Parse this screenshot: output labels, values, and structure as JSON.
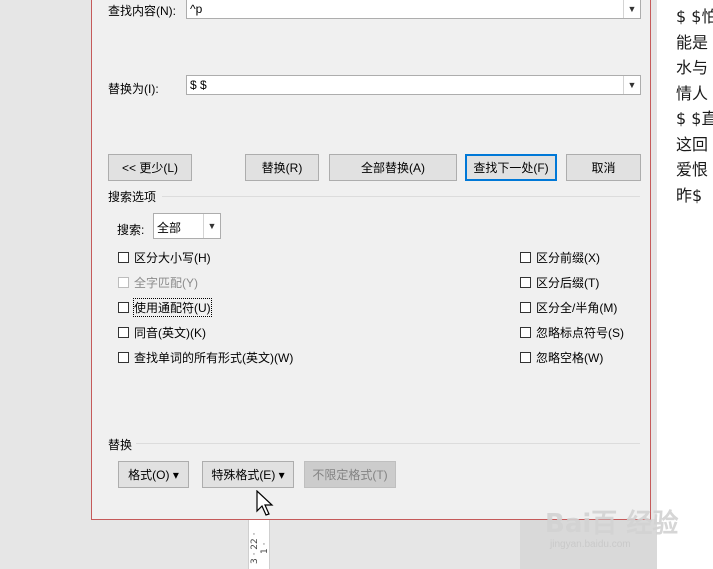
{
  "find": {
    "label": "查找内容(N):",
    "value": "^p"
  },
  "replace": {
    "label": "替换为(I):",
    "value": "$ $"
  },
  "buttons": {
    "less": "<< 更少(L)",
    "replace": "替换(R)",
    "replace_all": "全部替换(A)",
    "find_next": "查找下一处(F)",
    "cancel": "取消"
  },
  "search_options": {
    "title": "搜索选项",
    "search_label": "搜索:",
    "search_value": "全部",
    "left_options": [
      {
        "label": "区分大小写(H)",
        "checked": false,
        "enabled": true
      },
      {
        "label": "全字匹配(Y)",
        "checked": false,
        "enabled": false
      },
      {
        "label": "使用通配符(U)",
        "checked": false,
        "enabled": true
      },
      {
        "label": "同音(英文)(K)",
        "checked": false,
        "enabled": true
      },
      {
        "label": "查找单词的所有形式(英文)(W)",
        "checked": false,
        "enabled": true
      }
    ],
    "right_options": [
      {
        "label": "区分前缀(X)",
        "checked": false
      },
      {
        "label": "区分后缀(T)",
        "checked": false
      },
      {
        "label": "区分全/半角(M)",
        "checked": false
      },
      {
        "label": "忽略标点符号(S)",
        "checked": false
      },
      {
        "label": "忽略空格(W)",
        "checked": false
      }
    ]
  },
  "replace_section": {
    "title": "替换",
    "format_button": "格式(O) ▾",
    "special_button": "特殊格式(E) ▾",
    "no_format_button": "不限定格式(T)"
  },
  "document": {
    "lines": [
      "$ $怕",
      "能是",
      "水与",
      "情人",
      "$ $直",
      "这回",
      "爱恨",
      "昨$"
    ]
  },
  "ruler": {
    "text": "3 · 22 · 1 ·"
  },
  "watermark": {
    "logo": "Bai百 经验",
    "sub": "jingyan.baidu.com"
  }
}
